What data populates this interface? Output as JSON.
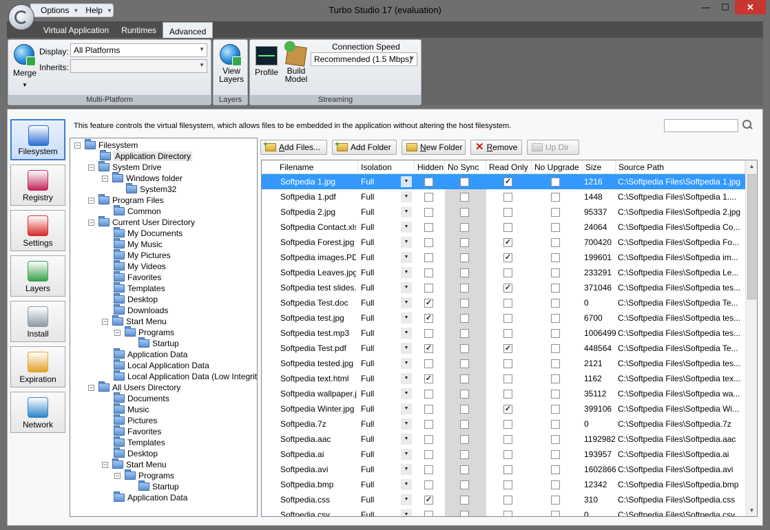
{
  "window": {
    "title": "Turbo Studio 17 (evaluation)",
    "min": "—",
    "max": "☐",
    "close": "✕"
  },
  "menus": [
    "Options",
    "Help"
  ],
  "tabs": [
    {
      "label": "Virtual Application",
      "active": false
    },
    {
      "label": "Runtimes",
      "active": false
    },
    {
      "label": "Advanced",
      "active": true
    }
  ],
  "ribbon": {
    "multi_platform": {
      "merge_label": "Merge",
      "display_label": "Display:",
      "display_value": "All Platforms",
      "inherits_label": "Inherits:",
      "inherits_value": "",
      "caption": "Multi-Platform"
    },
    "layers": {
      "view_layers_label": "View\nLayers",
      "caption": "Layers"
    },
    "streaming": {
      "profile_label": "Profile",
      "build_model_label": "Build\nModel",
      "connection_speed_label": "Connection Speed",
      "connection_speed_value": "Recommended (1.5 Mbps)",
      "caption": "Streaming"
    }
  },
  "nav": [
    {
      "label": "Filesystem",
      "active": true,
      "color": "#2c6ed5"
    },
    {
      "label": "Registry",
      "active": false,
      "color": "#c2275c"
    },
    {
      "label": "Settings",
      "active": false,
      "color": "#d82b2b"
    },
    {
      "label": "Layers",
      "active": false,
      "color": "#3aa04b"
    },
    {
      "label": "Install",
      "active": false,
      "color": "#8e9aa6"
    },
    {
      "label": "Expiration",
      "active": false,
      "color": "#e2a12a"
    },
    {
      "label": "Network",
      "active": false,
      "color": "#2d86c9"
    }
  ],
  "description": "This feature controls the virtual filesystem, which allows files to be embedded in the application without altering the host filesystem.",
  "search": {
    "value": ""
  },
  "tree": [
    {
      "label": "Filesystem",
      "depth": 0,
      "exp": "−"
    },
    {
      "label": "Application Directory",
      "depth": 1,
      "exp": "",
      "selected": true
    },
    {
      "label": "System Drive",
      "depth": 1,
      "exp": "−"
    },
    {
      "label": "Windows folder",
      "depth": 2,
      "exp": "−"
    },
    {
      "label": "System32",
      "depth": 3,
      "exp": ""
    },
    {
      "label": "Program Files",
      "depth": 1,
      "exp": "−"
    },
    {
      "label": "Common",
      "depth": 2,
      "exp": ""
    },
    {
      "label": "Current User Directory",
      "depth": 1,
      "exp": "−"
    },
    {
      "label": "My Documents",
      "depth": 2,
      "exp": ""
    },
    {
      "label": "My Music",
      "depth": 2,
      "exp": ""
    },
    {
      "label": "My Pictures",
      "depth": 2,
      "exp": ""
    },
    {
      "label": "My Videos",
      "depth": 2,
      "exp": ""
    },
    {
      "label": "Favorites",
      "depth": 2,
      "exp": ""
    },
    {
      "label": "Templates",
      "depth": 2,
      "exp": ""
    },
    {
      "label": "Desktop",
      "depth": 2,
      "exp": ""
    },
    {
      "label": "Downloads",
      "depth": 2,
      "exp": ""
    },
    {
      "label": "Start Menu",
      "depth": 2,
      "exp": "−"
    },
    {
      "label": "Programs",
      "depth": 3,
      "exp": "−"
    },
    {
      "label": "Startup",
      "depth": 4,
      "exp": ""
    },
    {
      "label": "Application Data",
      "depth": 2,
      "exp": ""
    },
    {
      "label": "Local Application Data",
      "depth": 2,
      "exp": ""
    },
    {
      "label": "Local Application Data (Low Integrity)",
      "depth": 2,
      "exp": ""
    },
    {
      "label": "All Users Directory",
      "depth": 1,
      "exp": "−"
    },
    {
      "label": "Documents",
      "depth": 2,
      "exp": ""
    },
    {
      "label": "Music",
      "depth": 2,
      "exp": ""
    },
    {
      "label": "Pictures",
      "depth": 2,
      "exp": ""
    },
    {
      "label": "Favorites",
      "depth": 2,
      "exp": ""
    },
    {
      "label": "Templates",
      "depth": 2,
      "exp": ""
    },
    {
      "label": "Desktop",
      "depth": 2,
      "exp": ""
    },
    {
      "label": "Start Menu",
      "depth": 2,
      "exp": "−"
    },
    {
      "label": "Programs",
      "depth": 3,
      "exp": "−"
    },
    {
      "label": "Startup",
      "depth": 4,
      "exp": ""
    },
    {
      "label": "Application Data",
      "depth": 2,
      "exp": ""
    }
  ],
  "toolbar": [
    {
      "label": "Add Files...",
      "u": "A",
      "rest": "dd Files...",
      "icon": "add-folder-icon",
      "disabled": false
    },
    {
      "label": "Add Folder",
      "u": "",
      "rest": "Add Folder",
      "icon": "add-folder-icon",
      "disabled": false
    },
    {
      "label": "New Folder",
      "u": "N",
      "rest": "ew Folder",
      "icon": "new-folder-icon",
      "disabled": false
    },
    {
      "label": "Remove",
      "u": "R",
      "rest": "emove",
      "icon": "remove-icon",
      "disabled": false
    },
    {
      "label": "Up Dir",
      "u": "",
      "rest": "Up Dir",
      "icon": "up-dir-icon",
      "disabled": true
    }
  ],
  "columns": [
    "Filename",
    "Isolation",
    "Hidden",
    "No Sync",
    "Read Only",
    "No Upgrade",
    "Size",
    "Source Path"
  ],
  "rows": [
    {
      "name": "Softpedia 1.jpg",
      "iso": "Full",
      "hidden": false,
      "nosync": false,
      "readonly": true,
      "noupgrade": false,
      "size": "1216",
      "path": "C:\\Softpedia Files\\Softpedia 1.jpg",
      "sel": true
    },
    {
      "name": "Softpedia 1.pdf",
      "iso": "Full",
      "hidden": false,
      "nosync": false,
      "readonly": false,
      "noupgrade": false,
      "size": "1448",
      "path": "C:\\Softpedia Files\\Softpedia 1...."
    },
    {
      "name": "Softpedia 2.jpg",
      "iso": "Full",
      "hidden": false,
      "nosync": false,
      "readonly": false,
      "noupgrade": false,
      "size": "95337",
      "path": "C:\\Softpedia Files\\Softpedia 2.jpg"
    },
    {
      "name": "Softpedia Contact.xls",
      "iso": "Full",
      "hidden": false,
      "nosync": false,
      "readonly": false,
      "noupgrade": false,
      "size": "24064",
      "path": "C:\\Softpedia Files\\Softpedia Co..."
    },
    {
      "name": "Softpedia Forest.jpg",
      "iso": "Full",
      "hidden": false,
      "nosync": false,
      "readonly": true,
      "noupgrade": false,
      "size": "700420",
      "path": "C:\\Softpedia Files\\Softpedia Fo..."
    },
    {
      "name": "Softpedia images.PDF",
      "iso": "Full",
      "hidden": false,
      "nosync": false,
      "readonly": true,
      "noupgrade": false,
      "size": "199601",
      "path": "C:\\Softpedia Files\\Softpedia im..."
    },
    {
      "name": "Softpedia Leaves.jpg",
      "iso": "Full",
      "hidden": false,
      "nosync": false,
      "readonly": false,
      "noupgrade": false,
      "size": "233291",
      "path": "C:\\Softpedia Files\\Softpedia Le..."
    },
    {
      "name": "Softpedia test slides...",
      "iso": "Full",
      "hidden": false,
      "nosync": false,
      "readonly": true,
      "noupgrade": false,
      "size": "371046",
      "path": "C:\\Softpedia Files\\Softpedia tes..."
    },
    {
      "name": "Softpedia Test.doc",
      "iso": "Full",
      "hidden": true,
      "nosync": false,
      "readonly": false,
      "noupgrade": false,
      "size": "0",
      "path": "C:\\Softpedia Files\\Softpedia Te..."
    },
    {
      "name": "Softpedia test.jpg",
      "iso": "Full",
      "hidden": true,
      "nosync": false,
      "readonly": false,
      "noupgrade": false,
      "size": "6700",
      "path": "C:\\Softpedia Files\\Softpedia tes..."
    },
    {
      "name": "Softpedia test.mp3",
      "iso": "Full",
      "hidden": false,
      "nosync": false,
      "readonly": false,
      "noupgrade": false,
      "size": "1006499",
      "path": "C:\\Softpedia Files\\Softpedia tes..."
    },
    {
      "name": "Softpedia Test.pdf",
      "iso": "Full",
      "hidden": true,
      "nosync": false,
      "readonly": true,
      "noupgrade": false,
      "size": "448564",
      "path": "C:\\Softpedia Files\\Softpedia Te..."
    },
    {
      "name": "Softpedia tested.jpg",
      "iso": "Full",
      "hidden": false,
      "nosync": false,
      "readonly": false,
      "noupgrade": false,
      "size": "2121",
      "path": "C:\\Softpedia Files\\Softpedia tes..."
    },
    {
      "name": "Softpedia text.html",
      "iso": "Full",
      "hidden": true,
      "nosync": false,
      "readonly": false,
      "noupgrade": false,
      "size": "1162",
      "path": "C:\\Softpedia Files\\Softpedia tex..."
    },
    {
      "name": "Softpedia wallpaper.j...",
      "iso": "Full",
      "hidden": false,
      "nosync": false,
      "readonly": false,
      "noupgrade": false,
      "size": "35112",
      "path": "C:\\Softpedia Files\\Softpedia wa..."
    },
    {
      "name": "Softpedia Winter.jpg",
      "iso": "Full",
      "hidden": false,
      "nosync": false,
      "readonly": true,
      "noupgrade": false,
      "size": "399106",
      "path": "C:\\Softpedia Files\\Softpedia Wi..."
    },
    {
      "name": "Softpedia.7z",
      "iso": "Full",
      "hidden": false,
      "nosync": false,
      "readonly": false,
      "noupgrade": false,
      "size": "0",
      "path": "C:\\Softpedia Files\\Softpedia.7z"
    },
    {
      "name": "Softpedia.aac",
      "iso": "Full",
      "hidden": false,
      "nosync": false,
      "readonly": false,
      "noupgrade": false,
      "size": "1192982",
      "path": "C:\\Softpedia Files\\Softpedia.aac"
    },
    {
      "name": "Softpedia.ai",
      "iso": "Full",
      "hidden": false,
      "nosync": false,
      "readonly": false,
      "noupgrade": false,
      "size": "193957",
      "path": "C:\\Softpedia Files\\Softpedia.ai"
    },
    {
      "name": "Softpedia.avi",
      "iso": "Full",
      "hidden": false,
      "nosync": false,
      "readonly": false,
      "noupgrade": false,
      "size": "1602866",
      "path": "C:\\Softpedia Files\\Softpedia.avi"
    },
    {
      "name": "Softpedia.bmp",
      "iso": "Full",
      "hidden": false,
      "nosync": false,
      "readonly": false,
      "noupgrade": false,
      "size": "12342",
      "path": "C:\\Softpedia Files\\Softpedia.bmp"
    },
    {
      "name": "Softpedia.css",
      "iso": "Full",
      "hidden": true,
      "nosync": false,
      "readonly": false,
      "noupgrade": false,
      "size": "310",
      "path": "C:\\Softpedia Files\\Softpedia.css"
    },
    {
      "name": "Softpedia.csv",
      "iso": "Full",
      "hidden": false,
      "nosync": false,
      "readonly": false,
      "noupgrade": false,
      "size": "0",
      "path": "C:\\Softpedia Files\\Softpedia.csv"
    }
  ],
  "colors": {
    "selection": "#3399ff",
    "close": "#c7372f",
    "frame": "#6f6f6f"
  }
}
